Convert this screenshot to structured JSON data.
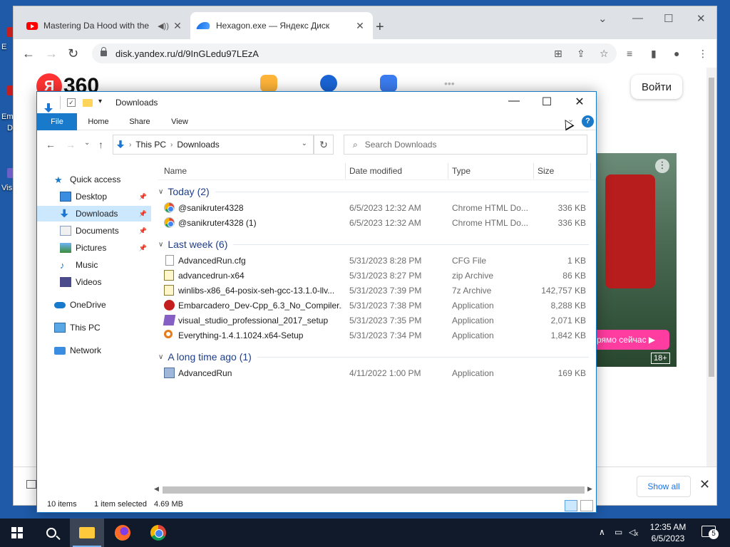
{
  "desktop": {
    "icon_labels": [
      "E",
      "Em",
      "D",
      "Vis"
    ]
  },
  "browser": {
    "tabs": [
      {
        "title": "Mastering Da Hood with the",
        "icon": "youtube-icon"
      },
      {
        "title": "Hexagon.exe — Яндекс Диск",
        "icon": "yandex-disk-icon"
      }
    ],
    "url": "disk.yandex.ru/d/9InGLedu97LEzA",
    "page": {
      "logo_letter": "Я",
      "logo_text": "360",
      "login_label": "Войти",
      "ad_cta": "рямо сейчас ▶",
      "ad_age": "18+"
    },
    "download_bar": {
      "show_all_label": "Show all"
    }
  },
  "explorer": {
    "title": "Downloads",
    "ribbon_tabs": [
      "File",
      "Home",
      "Share",
      "View"
    ],
    "breadcrumb": [
      "This PC",
      "Downloads"
    ],
    "search_placeholder": "Search Downloads",
    "nav": [
      {
        "label": "Quick access",
        "icon": "star-icon"
      },
      {
        "label": "Desktop",
        "icon": "desktop-folder-icon",
        "pinned": true
      },
      {
        "label": "Downloads",
        "icon": "download-folder-icon",
        "pinned": true,
        "selected": true
      },
      {
        "label": "Documents",
        "icon": "documents-folder-icon",
        "pinned": true
      },
      {
        "label": "Pictures",
        "icon": "pictures-folder-icon",
        "pinned": true
      },
      {
        "label": "Music",
        "icon": "music-folder-icon"
      },
      {
        "label": "Videos",
        "icon": "videos-folder-icon"
      },
      {
        "label": "OneDrive",
        "icon": "onedrive-icon"
      },
      {
        "label": "This PC",
        "icon": "this-pc-icon"
      },
      {
        "label": "Network",
        "icon": "network-icon"
      }
    ],
    "columns": [
      "Name",
      "Date modified",
      "Type",
      "Size"
    ],
    "groups": [
      {
        "label": "Today (2)",
        "files": [
          {
            "name": "@sanikruter4328",
            "date": "6/5/2023 12:32 AM",
            "type": "Chrome HTML Do...",
            "size": "336 KB",
            "icon": "chrome-html-icon"
          },
          {
            "name": "@sanikruter4328 (1)",
            "date": "6/5/2023 12:32 AM",
            "type": "Chrome HTML Do...",
            "size": "336 KB",
            "icon": "chrome-html-icon"
          }
        ]
      },
      {
        "label": "Last week (6)",
        "files": [
          {
            "name": "AdvancedRun.cfg",
            "date": "5/31/2023 8:28 PM",
            "type": "CFG File",
            "size": "1 KB",
            "icon": "cfg-file-icon"
          },
          {
            "name": "advancedrun-x64",
            "date": "5/31/2023 8:27 PM",
            "type": "zip Archive",
            "size": "86 KB",
            "icon": "zip-archive-icon"
          },
          {
            "name": "winlibs-x86_64-posix-seh-gcc-13.1.0-llv...",
            "date": "5/31/2023 7:39 PM",
            "type": "7z Archive",
            "size": "142,757 KB",
            "icon": "7z-archive-icon"
          },
          {
            "name": "Embarcadero_Dev-Cpp_6.3_No_Compiler...",
            "date": "5/31/2023 7:38 PM",
            "type": "Application",
            "size": "8,288 KB",
            "icon": "devcpp-app-icon"
          },
          {
            "name": "visual_studio_professional_2017_setup",
            "date": "5/31/2023 7:35 PM",
            "type": "Application",
            "size": "2,071 KB",
            "icon": "visual-studio-app-icon"
          },
          {
            "name": "Everything-1.4.1.1024.x64-Setup",
            "date": "5/31/2023 7:34 PM",
            "type": "Application",
            "size": "1,842 KB",
            "icon": "everything-app-icon"
          }
        ]
      },
      {
        "label": "A long time ago (1)",
        "files": [
          {
            "name": "AdvancedRun",
            "date": "4/11/2022 1:00 PM",
            "type": "Application",
            "size": "169 KB",
            "icon": "advancedrun-app-icon"
          }
        ]
      }
    ],
    "status": {
      "items": "10 items",
      "selected": "1 item selected",
      "size": "4.69 MB"
    }
  },
  "taskbar": {
    "time": "12:35 AM",
    "date": "6/5/2023",
    "notification_count": "5"
  },
  "colors": {
    "accent": "#1979ca",
    "selected_bg": "#cce8ff",
    "taskbar_bg": "#101a2a"
  }
}
